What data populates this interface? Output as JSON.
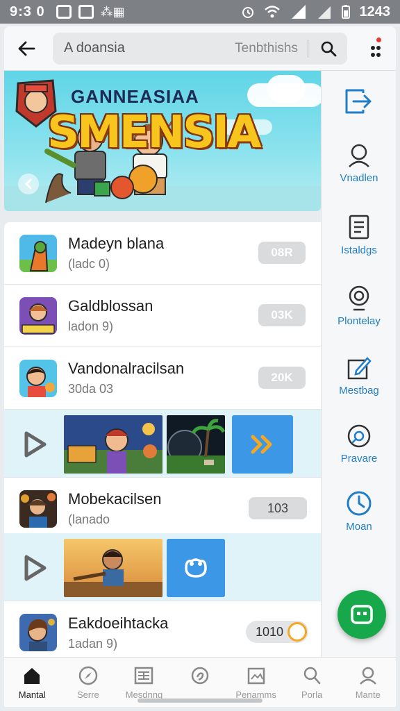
{
  "status_bar": {
    "time": "9:3 0",
    "right_time": "1243"
  },
  "app_bar": {
    "search_query": "A doansia",
    "search_placeholder": "Tenbthishs",
    "icons": [
      "back-arrow-icon",
      "search-icon",
      "more-vertical-icon"
    ]
  },
  "banner": {
    "title_small": "GANNEASIAA",
    "title_big": "SMENSIA"
  },
  "list": {
    "items": [
      {
        "name": "Madeyn blana",
        "sub": "(ladc 0)",
        "size": "08R"
      },
      {
        "name": "Galdblossan",
        "sub": "ladon 9)",
        "size": "03K"
      },
      {
        "name": "Vandonalracilsan",
        "sub": "30da 03",
        "size": "20K"
      },
      {
        "name": "Mobekacilsen",
        "sub": "(lanado",
        "size": "103"
      },
      {
        "name": "Eakdoeihtacka",
        "sub": "1adan 9)",
        "size": "1010",
        "toggle_on": true
      }
    ]
  },
  "rail": {
    "items": [
      {
        "label": "",
        "icon": "export-icon"
      },
      {
        "label": "Vnadlen",
        "icon": "user-icon"
      },
      {
        "label": "Istaldgs",
        "icon": "document-icon"
      },
      {
        "label": "Plontelay",
        "icon": "webcam-icon"
      },
      {
        "label": "Mestbag",
        "icon": "edit-icon"
      },
      {
        "label": "Pravare",
        "icon": "disc-icon"
      },
      {
        "label": "Moan",
        "icon": "clock-icon"
      }
    ]
  },
  "fab": {
    "icon": "game-icon"
  },
  "bottom_nav": {
    "items": [
      {
        "label": "Mantal",
        "icon": "home-icon",
        "active": true
      },
      {
        "label": "Serre",
        "icon": "compass-icon"
      },
      {
        "label": "Mesdnng",
        "icon": "news-icon"
      },
      {
        "label": "",
        "icon": "support-icon"
      },
      {
        "label": "Penamms",
        "icon": "image-icon"
      },
      {
        "label": "Porla",
        "icon": "search-icon"
      },
      {
        "label": "Mante",
        "icon": "profile-icon"
      }
    ]
  },
  "colors": {
    "accent_blue": "#1f7ec7",
    "fab_green": "#18a84c",
    "toggle_orange": "#f5a623"
  }
}
